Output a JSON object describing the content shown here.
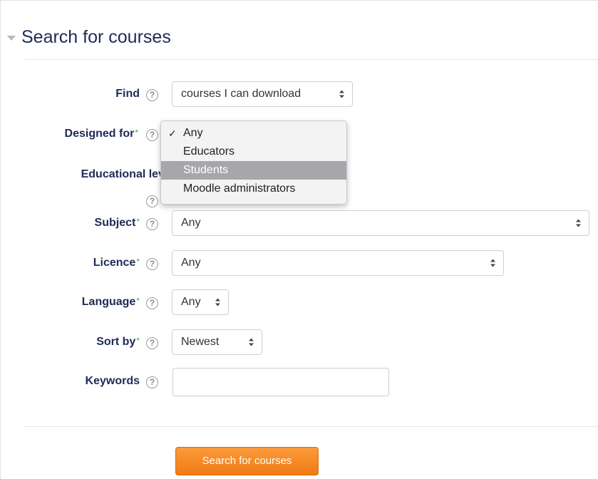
{
  "legend": {
    "title": "Search for courses",
    "collapse_icon": "triangle-down-icon"
  },
  "form": {
    "find": {
      "label": "Find",
      "value": "courses I can download"
    },
    "designed_for": {
      "label": "Designed for",
      "required": "*"
    },
    "educational_level": {
      "label": "Educational level",
      "required": "*"
    },
    "subject": {
      "label": "Subject",
      "required": "*",
      "value": "Any"
    },
    "licence": {
      "label": "Licence",
      "required": "*",
      "value": "Any"
    },
    "language": {
      "label": "Language",
      "required": "*",
      "value": "Any"
    },
    "sort_by": {
      "label": "Sort by",
      "required": "*",
      "value": "Newest"
    },
    "keywords": {
      "label": "Keywords",
      "value": ""
    },
    "help_icon_glyph": "?"
  },
  "dropdown": {
    "options": [
      "Any",
      "Educators",
      "Students",
      "Moodle administrators"
    ],
    "selected": "Any",
    "highlighted": "Students",
    "check_glyph": "✓"
  },
  "submit": {
    "label": "Search for courses"
  },
  "colors": {
    "label": "#1f2a57",
    "required": "#3fae49",
    "button": "#f58620",
    "highlight": "#a7a7ab"
  }
}
